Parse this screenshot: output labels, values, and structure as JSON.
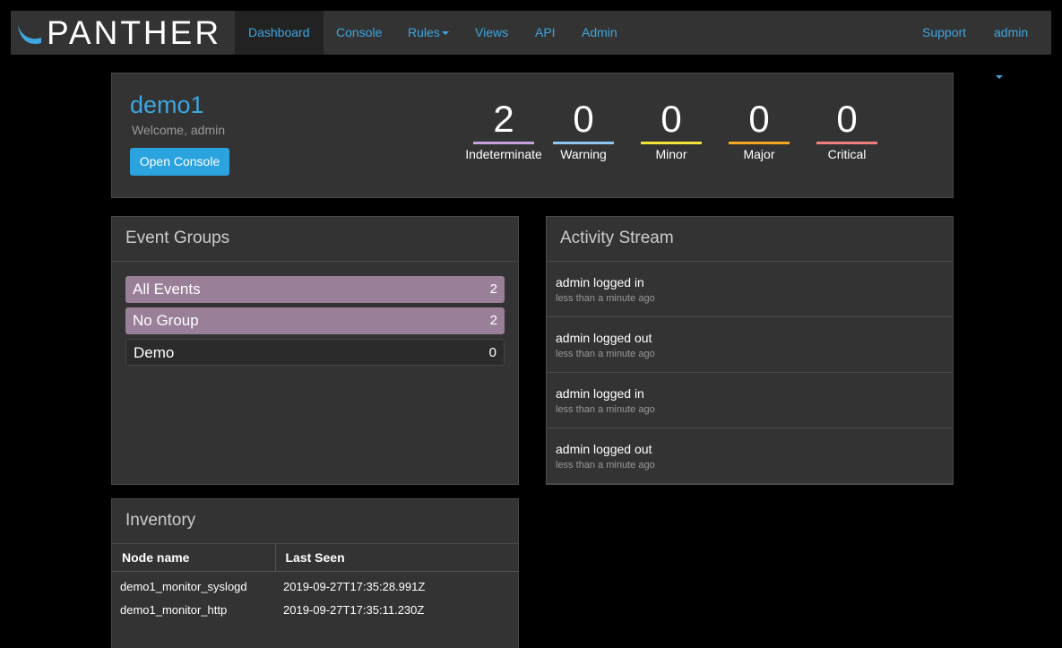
{
  "brand": {
    "name": "PANTHER"
  },
  "nav": {
    "left": [
      {
        "label": "Dashboard",
        "active": true
      },
      {
        "label": "Console"
      },
      {
        "label": "Rules",
        "dropdown": true
      },
      {
        "label": "Views"
      },
      {
        "label": "API"
      },
      {
        "label": "Admin"
      }
    ],
    "right": [
      {
        "label": "Support"
      },
      {
        "label": "admin",
        "dropdown": true
      }
    ]
  },
  "summary": {
    "site": "demo1",
    "welcome": "Welcome, admin",
    "open_console": "Open Console",
    "severities": [
      {
        "label": "Indeterminate",
        "count": "2",
        "color": "#c9a0dc"
      },
      {
        "label": "Warning",
        "count": "0",
        "color": "#8ec6f0"
      },
      {
        "label": "Minor",
        "count": "0",
        "color": "#f3e23a"
      },
      {
        "label": "Major",
        "count": "0",
        "color": "#f5a623"
      },
      {
        "label": "Critical",
        "count": "0",
        "color": "#f08080"
      }
    ]
  },
  "event_groups": {
    "title": "Event Groups",
    "items": [
      {
        "name": "All Events",
        "count": "2"
      },
      {
        "name": "No Group",
        "count": "2"
      },
      {
        "name": "Demo",
        "count": "0"
      }
    ]
  },
  "activity": {
    "title": "Activity Stream",
    "items": [
      {
        "text": "admin logged in",
        "time": "less than a minute ago"
      },
      {
        "text": "admin logged out",
        "time": "less than a minute ago"
      },
      {
        "text": "admin logged in",
        "time": "less than a minute ago"
      },
      {
        "text": "admin logged out",
        "time": "less than a minute ago"
      }
    ]
  },
  "inventory": {
    "title": "Inventory",
    "columns": [
      "Node name",
      "Last Seen"
    ],
    "rows": [
      [
        "demo1_monitor_syslogd",
        "2019-09-27T17:35:28.991Z"
      ],
      [
        "demo1_monitor_http",
        "2019-09-27T17:35:11.230Z"
      ]
    ]
  }
}
